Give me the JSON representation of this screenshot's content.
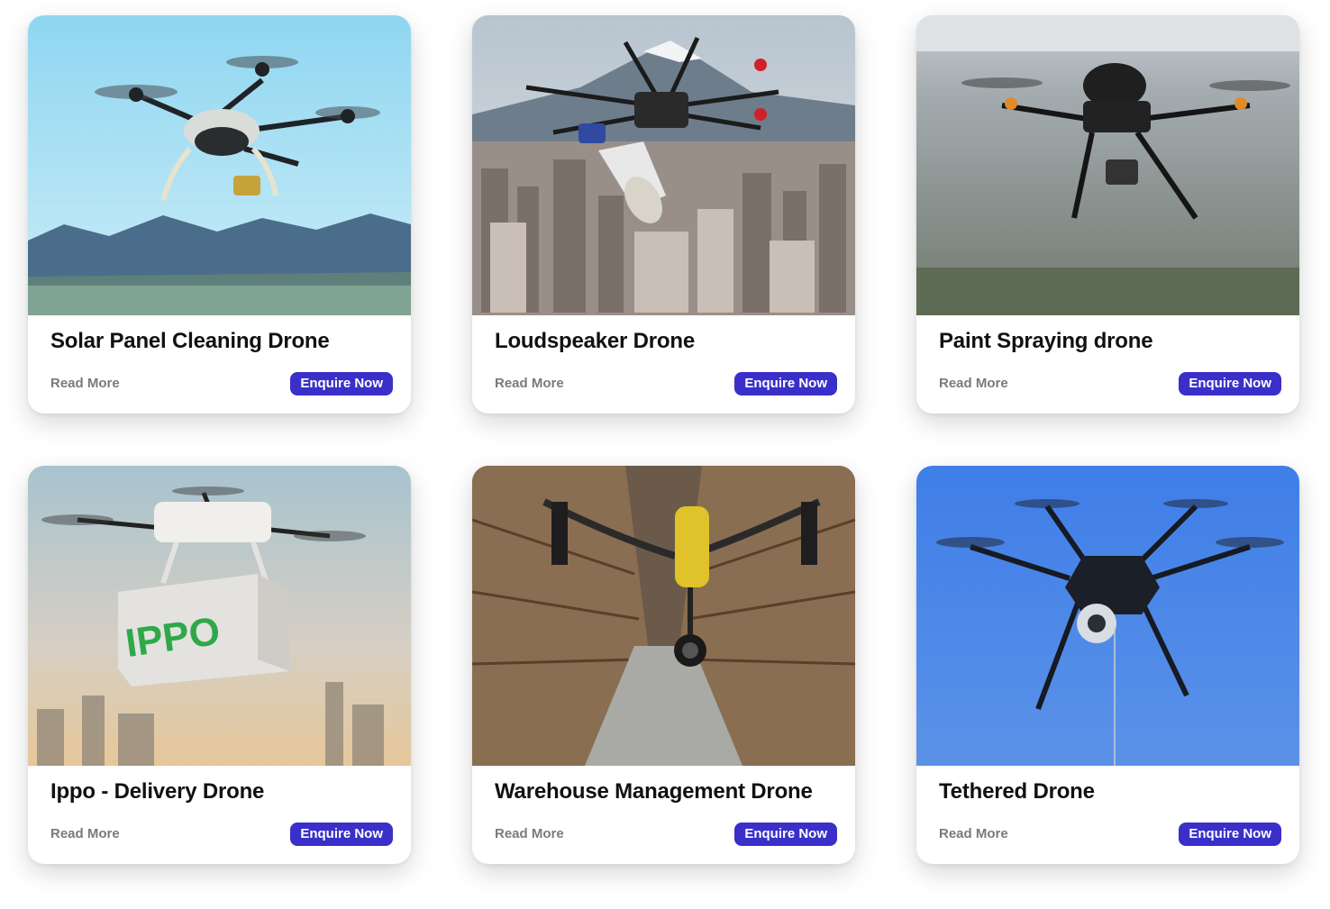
{
  "cards": [
    {
      "title": "Solar Panel Cleaning Drone",
      "read_more": "Read More",
      "enquire": "Enquire Now",
      "image_icon": "solar-panel-drone-photo"
    },
    {
      "title": "Loudspeaker Drone",
      "read_more": "Read More",
      "enquire": "Enquire Now",
      "image_icon": "loudspeaker-drone-photo"
    },
    {
      "title": "Paint Spraying drone",
      "read_more": "Read More",
      "enquire": "Enquire Now",
      "image_icon": "paint-spraying-drone-photo"
    },
    {
      "title": "Ippo - Delivery Drone",
      "read_more": "Read More",
      "enquire": "Enquire Now",
      "image_icon": "delivery-drone-photo",
      "package_label": "IPPO"
    },
    {
      "title": "Warehouse Management Drone",
      "read_more": "Read More",
      "enquire": "Enquire Now",
      "image_icon": "warehouse-drone-photo"
    },
    {
      "title": "Tethered Drone",
      "read_more": "Read More",
      "enquire": "Enquire Now",
      "image_icon": "tethered-drone-photo"
    }
  ],
  "colors": {
    "accent": "#3a2fc9",
    "title_text": "#111111",
    "muted_text": "#7a7a7a"
  }
}
